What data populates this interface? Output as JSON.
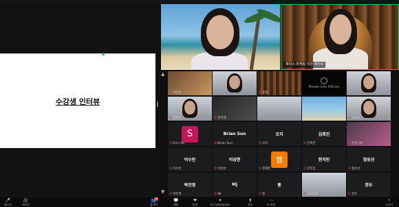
{
  "share": {
    "slide_title": "수강생 인터뷰"
  },
  "speakers": [
    {
      "name": ""
    },
    {
      "name": "체이스 마케팅 지원 에이트"
    }
  ],
  "gallery": {
    "tiles": [
      {
        "label": "아침엉",
        "kind": "video-warm"
      },
      {
        "label": "",
        "kind": "video-face"
      },
      {
        "label": "윤정",
        "kind": "video-shelf"
      },
      {
        "label": "",
        "kind": "logo",
        "logo_text": "Pmster Ivan ORCam"
      },
      {
        "label": "",
        "kind": "video-face"
      },
      {
        "label": "정성서",
        "kind": "video-face"
      },
      {
        "label": "안지혜",
        "kind": "video-dark"
      },
      {
        "label": "",
        "kind": "video-room"
      },
      {
        "label": "",
        "kind": "video-beach"
      },
      {
        "label": "esise",
        "kind": "video-face"
      },
      {
        "label": "Erin Ha",
        "kind": "avatar-s",
        "avatar_letter": "S"
      },
      {
        "label": "Brian Sun",
        "center": "Brian Sun",
        "kind": "name"
      },
      {
        "label": "오지",
        "center": "오지",
        "kind": "name"
      },
      {
        "label": "김희진",
        "center": "김희진",
        "kind": "name"
      },
      {
        "label": "연주 (R)",
        "kind": "video-pink"
      },
      {
        "label": "이수빈",
        "center": "이수빈",
        "kind": "name"
      },
      {
        "label": "이성현",
        "center": "이성현",
        "kind": "name"
      },
      {
        "label": "정혜진",
        "kind": "avatar-h",
        "avatar_letter": "햄"
      },
      {
        "label": "한지민",
        "center": "한지민",
        "kind": "name"
      },
      {
        "label": "정유선",
        "center": "정유선",
        "kind": "name"
      },
      {
        "label": "박진영",
        "center": "박진영",
        "kind": "name"
      },
      {
        "label": "MJ",
        "center": "Mj",
        "kind": "name"
      },
      {
        "label": "홍",
        "center": "홍",
        "kind": "name"
      },
      {
        "label": "LCG 04",
        "kind": "video-room"
      },
      {
        "label": "한두",
        "center": "한두",
        "kind": "name"
      }
    ],
    "nav_up": "▲",
    "nav_down": "▼"
  },
  "toolbar": {
    "left": [
      {
        "icon": "🎤",
        "label": "음소거",
        "red": true
      },
      {
        "icon": "🎥",
        "label": "비디오",
        "red": true
      }
    ],
    "center": [
      {
        "icon": "👥",
        "label": "참가자",
        "badge": "39"
      },
      {
        "icon": "💬",
        "label": "채팅"
      },
      {
        "icon": "❤",
        "label": "반응"
      },
      {
        "icon": "✦",
        "label": "AI Companion"
      },
      {
        "icon": "⬆",
        "label": "공유"
      },
      {
        "icon": "⋯",
        "label": "더 보기"
      }
    ],
    "right": [
      {
        "icon": "✕",
        "label": "나가기",
        "red": true
      }
    ]
  },
  "colors": {
    "active_speaker_border": "#19c46c",
    "avatar_s": "#c2185b",
    "avatar_h": "#f57c00",
    "mic_off": "#e0453c"
  }
}
